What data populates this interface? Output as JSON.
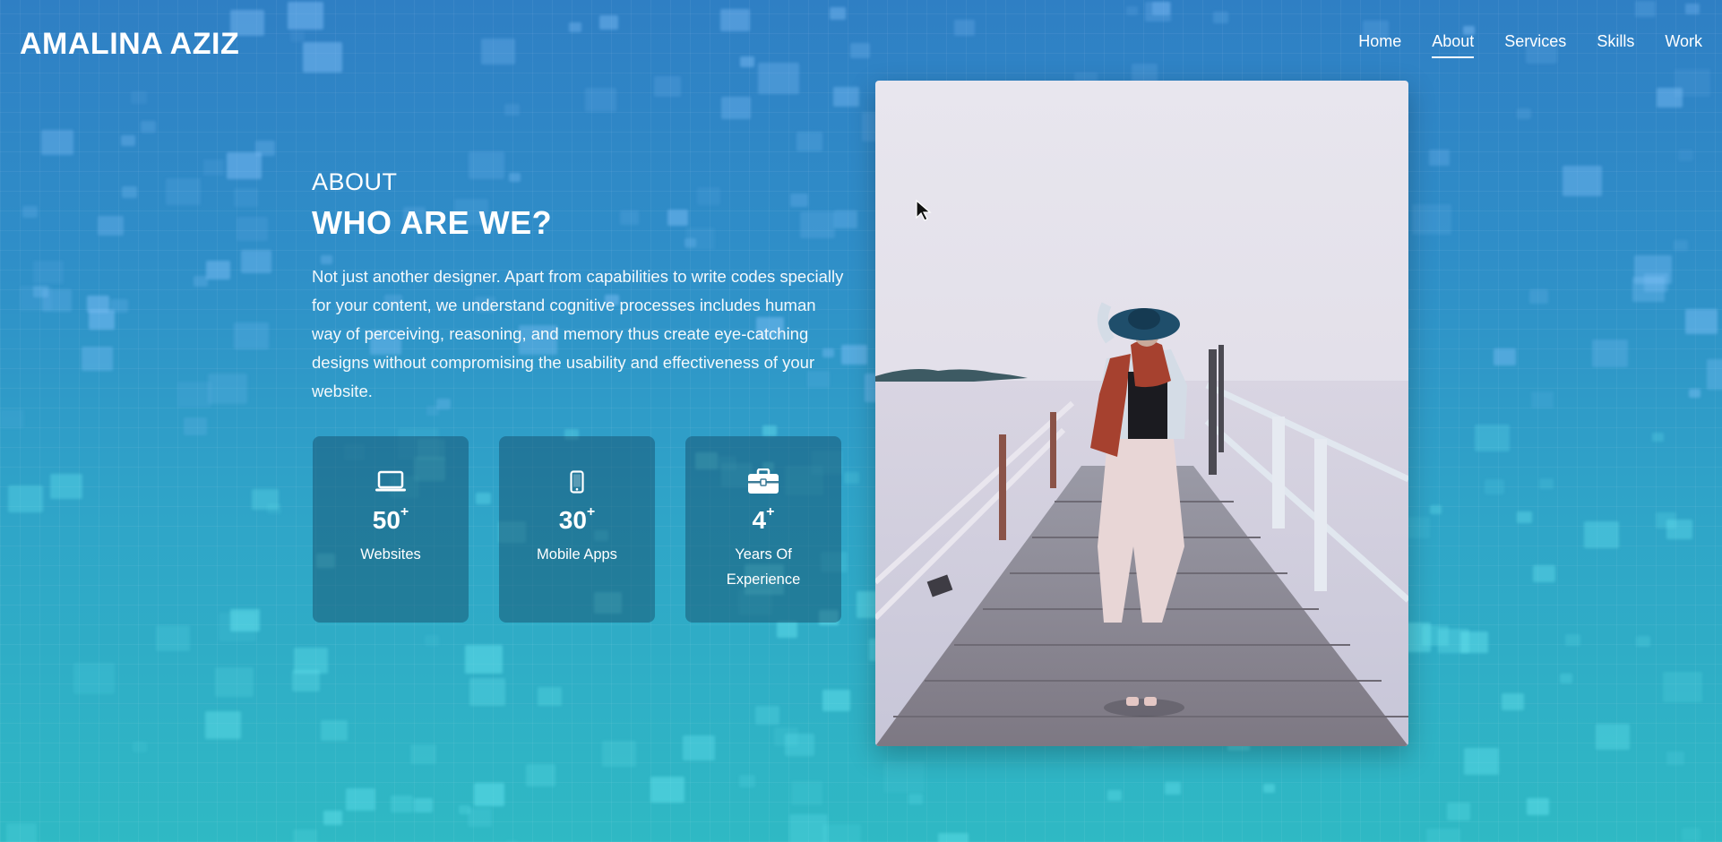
{
  "header": {
    "logo": "AMALINA AZIZ",
    "nav": [
      {
        "label": "Home",
        "active": false
      },
      {
        "label": "About",
        "active": true
      },
      {
        "label": "Services",
        "active": false
      },
      {
        "label": "Skills",
        "active": false
      },
      {
        "label": "Work",
        "active": false
      }
    ]
  },
  "about": {
    "eyebrow": "ABOUT",
    "title": "WHO ARE WE?",
    "description": "Not just another designer. Apart from capabilities to write codes specially for your content, we understand cognitive processes includes human way of perceiving, reasoning, and memory thus create eye-catching designs without compromising the usability and effectiveness of your website."
  },
  "stats": [
    {
      "icon": "laptop-icon",
      "value": "50",
      "suffix": "+",
      "label": "Websites"
    },
    {
      "icon": "mobile-icon",
      "value": "30",
      "suffix": "+",
      "label": "Mobile Apps"
    },
    {
      "icon": "briefcase-icon",
      "value": "4",
      "suffix": "+",
      "label": "Years Of Experience"
    }
  ],
  "colors": {
    "background_top": "#2f7fc4",
    "background_bottom": "#2fb9c4",
    "card_background": "rgba(20,70,100,0.45)",
    "text": "#ffffff"
  }
}
